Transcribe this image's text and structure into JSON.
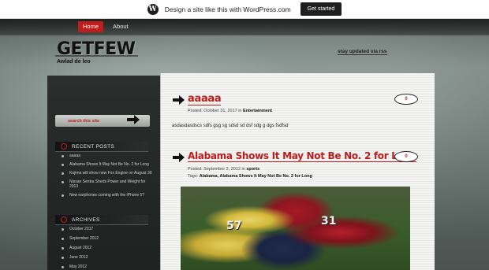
{
  "wp_banner": {
    "logo_letter": "W",
    "text": "Design a site like this with WordPress.com",
    "button": "Get started"
  },
  "nav": [
    {
      "label": "Home",
      "active": true
    },
    {
      "label": "About",
      "active": false
    }
  ],
  "site": {
    "title": "GETFEW",
    "tagline": "Awlad de leo",
    "rss": "stay updated via rss"
  },
  "sidebar": {
    "search_placeholder": "search this site",
    "recent_heading": "RECENT POSTS",
    "recent_posts": [
      "aaaaa",
      "Alabama Shows It May Not Be No. 2 for Long",
      "Kojima will show new Fox Engine on August 30",
      "Nissan Sentra Sheds Power and Weight for 2013",
      "New earphones coming with the iPhone 5?"
    ],
    "archives_heading": "ARCHIVES",
    "archives": [
      "October 2017",
      "September 2012",
      "August 2012",
      "June 2012",
      "May 2012"
    ]
  },
  "posts": [
    {
      "title": "aaaaa",
      "meta_prefix": "Posted: October 31, 2017 in ",
      "category": "Entertainment",
      "body": "asdasdasdscs sdfs gsg sg sdsd sd dsf sdg g dgs  fsdfsd",
      "comments": "0"
    },
    {
      "title": "Alabama Shows It May Not Be No. 2 for Long",
      "meta_prefix": "Posted: September 2, 2012 in ",
      "category": "sports",
      "tags_prefix": "Tags: ",
      "tags": "Alabama, Alabama Shows It May Not Be No. 2 for Long",
      "comments": "0",
      "image_numbers": [
        "57",
        "31"
      ]
    }
  ],
  "colors": {
    "accent": "#c01c1c",
    "banner_bg": "#ffffff",
    "sidebar_bg": "#2a2e2d"
  }
}
